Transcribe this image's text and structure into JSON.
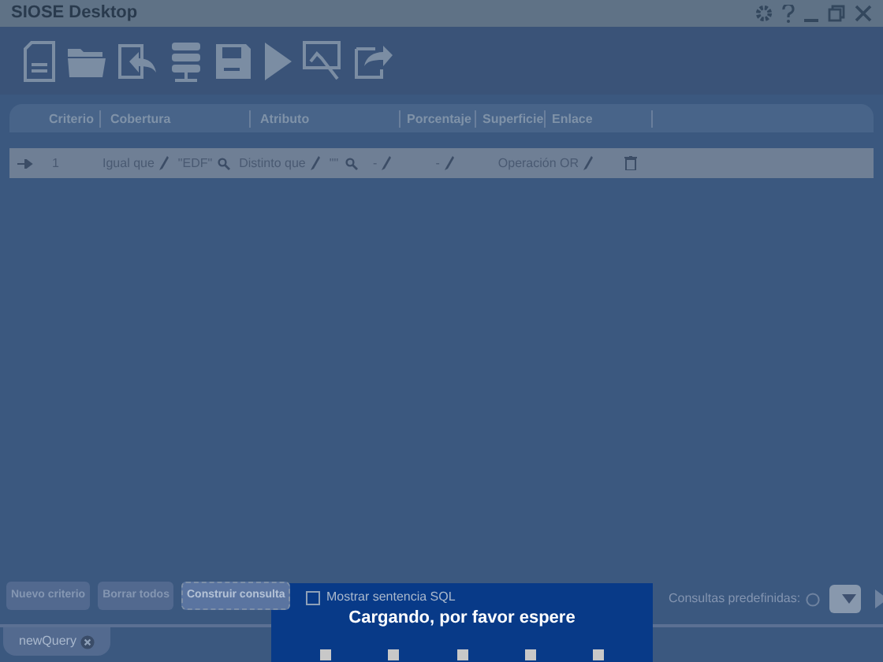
{
  "window": {
    "title": "SIOSE Desktop"
  },
  "table": {
    "columns": [
      "Criterio",
      "Cobertura",
      "Atributo",
      "Porcentaje",
      "Superficie",
      "Enlace"
    ],
    "rows": [
      {
        "criterio": "1",
        "cobertura_op": "Igual que",
        "cobertura_value": "\"EDF\"",
        "atributo_op": "Distinto que",
        "atributo_value": "\"\"",
        "porcentaje": "-",
        "superficie": "-",
        "enlace": "Operación OR"
      }
    ]
  },
  "buttons": [
    "Nuevo criterio",
    "Borrar todos",
    "Construir consulta"
  ],
  "sql_checkbox": {
    "label": "Mostrar sentencia SQL",
    "checked": false
  },
  "predefined": {
    "label": "Consultas predefinidas:"
  },
  "tabs": [
    {
      "label": "newQuery",
      "selected": true
    }
  ],
  "loading": {
    "message": "Cargando, por favor espere"
  }
}
